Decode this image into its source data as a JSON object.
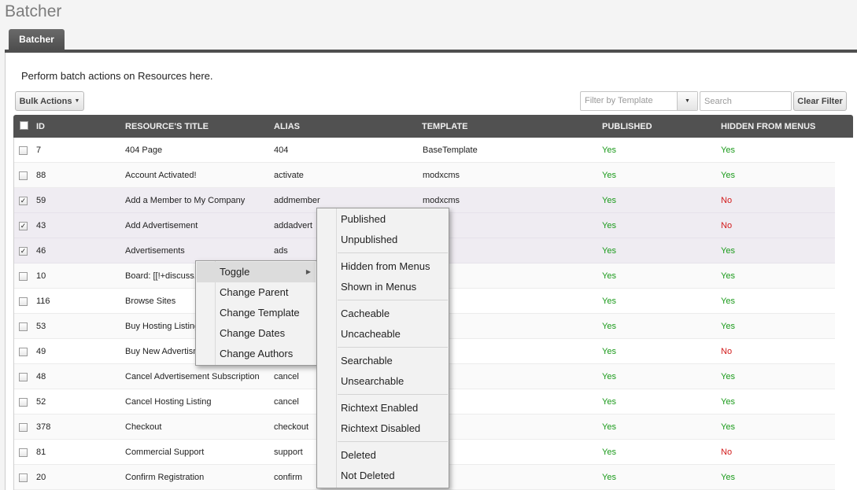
{
  "page": {
    "title": "Batcher"
  },
  "tab": {
    "label": "Batcher"
  },
  "intro": "Perform batch actions on Resources here.",
  "toolbar": {
    "bulk_actions_label": "Bulk Actions",
    "filter_placeholder": "Filter by Template",
    "search_placeholder": "Search",
    "clear_filter_label": "Clear Filter"
  },
  "grid": {
    "columns": [
      "ID",
      "RESOURCE'S TITLE",
      "ALIAS",
      "TEMPLATE",
      "PUBLISHED",
      "HIDDEN FROM MENUS"
    ],
    "rows": [
      {
        "checked": false,
        "id": "7",
        "title": "404 Page",
        "alias": "404",
        "template": "BaseTemplate",
        "published": "Yes",
        "hidden": "Yes"
      },
      {
        "checked": false,
        "id": "88",
        "title": "Account Activated!",
        "alias": "activate",
        "template": "modxcms",
        "published": "Yes",
        "hidden": "Yes"
      },
      {
        "checked": true,
        "id": "59",
        "title": "Add a Member to My Company",
        "alias": "addmember",
        "template": "modxcms",
        "published": "Yes",
        "hidden": "No"
      },
      {
        "checked": true,
        "id": "43",
        "title": "Add Advertisement",
        "alias": "addadvert",
        "template": "ms",
        "published": "Yes",
        "hidden": "No"
      },
      {
        "checked": true,
        "id": "46",
        "title": "Advertisements",
        "alias": "ads",
        "template": "ms",
        "published": "Yes",
        "hidden": "Yes"
      },
      {
        "checked": false,
        "id": "10",
        "title": "Board: [[!+discuss.",
        "alias": "",
        "template": "orums",
        "published": "Yes",
        "hidden": "Yes"
      },
      {
        "checked": false,
        "id": "116",
        "title": "Browse Sites",
        "alias": "",
        "template": "ms",
        "published": "Yes",
        "hidden": "Yes"
      },
      {
        "checked": false,
        "id": "53",
        "title": "Buy Hosting Listing",
        "alias": "",
        "template": "ms",
        "published": "Yes",
        "hidden": "Yes"
      },
      {
        "checked": false,
        "id": "49",
        "title": "Buy New Advertism",
        "alias": "",
        "template": "ms",
        "published": "Yes",
        "hidden": "No"
      },
      {
        "checked": false,
        "id": "48",
        "title": "Cancel Advertisement Subscription",
        "alias": "cancel",
        "template": "ms",
        "published": "Yes",
        "hidden": "Yes"
      },
      {
        "checked": false,
        "id": "52",
        "title": "Cancel Hosting Listing",
        "alias": "cancel",
        "template": "ms",
        "published": "Yes",
        "hidden": "Yes"
      },
      {
        "checked": false,
        "id": "378",
        "title": "Checkout",
        "alias": "checkout",
        "template": "ms",
        "published": "Yes",
        "hidden": "Yes"
      },
      {
        "checked": false,
        "id": "81",
        "title": "Commercial Support",
        "alias": "support",
        "template": "ms",
        "published": "Yes",
        "hidden": "No"
      },
      {
        "checked": false,
        "id": "20",
        "title": "Confirm Registration",
        "alias": "confirm",
        "template": "orums",
        "published": "Yes",
        "hidden": "Yes"
      }
    ]
  },
  "context_menu": {
    "items": [
      "Toggle",
      "Change Parent",
      "Change Template",
      "Change Dates",
      "Change Authors"
    ]
  },
  "toggle_submenu": {
    "groups": [
      [
        "Published",
        "Unpublished"
      ],
      [
        "Hidden from Menus",
        "Shown in Menus"
      ],
      [
        "Cacheable",
        "Uncacheable"
      ],
      [
        "Searchable",
        "Unsearchable"
      ],
      [
        "Richtext Enabled",
        "Richtext Disabled"
      ],
      [
        "Deleted",
        "Not Deleted"
      ]
    ]
  },
  "colors": {
    "yes": "#1a9a1a",
    "no": "#d21a1a",
    "header": "#515151"
  }
}
